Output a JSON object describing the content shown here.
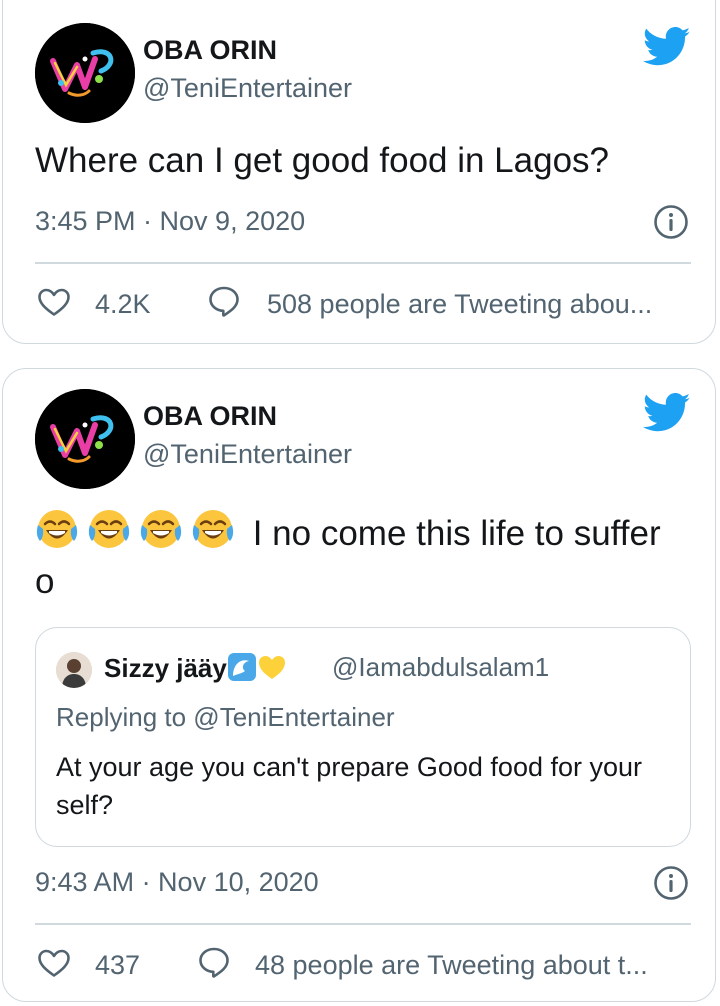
{
  "tweets": [
    {
      "name": "OBA ORIN",
      "handle": "@TeniEntertainer",
      "text": "Where can I get good food in Lagos?",
      "timestamp": "3:45 PM · Nov 9, 2020",
      "likes": "4.2K",
      "discussion": "508 people are Tweeting abou..."
    },
    {
      "name": "OBA ORIN",
      "handle": "@TeniEntertainer",
      "text_emojis": [
        "face-with-tears-of-joy",
        "face-with-tears-of-joy",
        "face-with-tears-of-joy",
        "face-with-tears-of-joy"
      ],
      "text": " I no come this life to suffer o",
      "quote": {
        "name": "Sizzy jääy",
        "name_emojis": [
          "water-wave",
          "yellow-heart"
        ],
        "handle": "@Iamabdulsalam1",
        "replying_to": "Replying to @TeniEntertainer",
        "text": "At your age you can't prepare Good food for your self?"
      },
      "timestamp": "9:43 AM · Nov 10, 2020",
      "likes": "437",
      "discussion": "48 people are Tweeting about t..."
    }
  ],
  "icons": {
    "brand": "twitter-bird-icon",
    "info": "info-icon",
    "like": "heart-icon",
    "discussion": "speech-bubble-icon"
  },
  "colors": {
    "brand": "#1da1f2",
    "border": "#cfd9de",
    "secondary_text": "#536471",
    "primary_text": "#14171a"
  }
}
